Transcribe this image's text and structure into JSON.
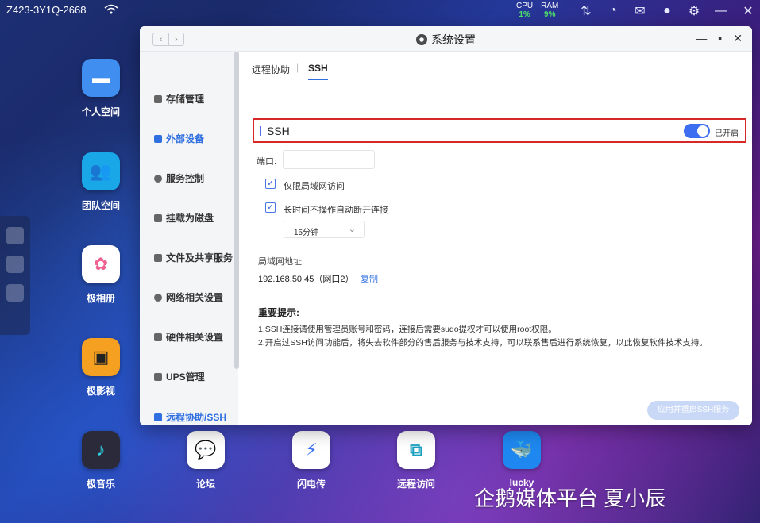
{
  "topbar": {
    "device_name": "Z423-3Y1Q-2668",
    "cpu_label": "CPU",
    "cpu_value": "1%",
    "ram_label": "RAM",
    "ram_value": "9%",
    "icons": [
      "transfer-icon",
      "speed-icon",
      "mail-icon",
      "user-icon",
      "gear-icon",
      "minimize-icon",
      "close-icon"
    ]
  },
  "desktop": {
    "icons": [
      {
        "label": "个人空间",
        "color": "#3f8ef0"
      },
      {
        "label": "团队空间",
        "color": "#1aa7e8"
      },
      {
        "label": "极相册",
        "color": "#ffffff"
      },
      {
        "label": "极影视",
        "color": "#f5a020"
      },
      {
        "label": "极音乐",
        "color": "#2a2a3a"
      },
      {
        "label": "论坛",
        "color": "#ffffff"
      },
      {
        "label": "闪电传",
        "color": "#ffffff"
      },
      {
        "label": "远程访问",
        "color": "#ffffff"
      },
      {
        "label": "lucky",
        "color": "#1e88f0"
      }
    ]
  },
  "window": {
    "title": "系统设置",
    "sidebar": [
      {
        "label": "存储管理"
      },
      {
        "label": "外部设备"
      },
      {
        "label": "服务控制"
      },
      {
        "label": "挂载为磁盘"
      },
      {
        "label": "文件及共享服务"
      },
      {
        "label": "网络相关设置"
      },
      {
        "label": "硬件相关设置"
      },
      {
        "label": "UPS管理"
      },
      {
        "label": "远程协助/SSH"
      }
    ],
    "tabs": {
      "remote": "远程协助",
      "ssh": "SSH"
    },
    "ssh": {
      "label": "SSH",
      "toggle_state": "已开启",
      "enabled": true,
      "port_label": "端口:",
      "port_value": "",
      "lan_only_label": "仅限局域网访问",
      "auto_disconnect_label": "长时间不操作自动断开连接",
      "timeout_value": "15分钟",
      "lan_address_label": "局域网地址:",
      "lan_address_value": "192.168.50.45（网口2）",
      "copy_label": "复制",
      "important_title": "重要提示:",
      "note1": "1.SSH连接请使用管理员账号和密码，连接后需要sudo提权才可以使用root权限。",
      "note2": "2.开启过SSH访问功能后，将失去软件部分的售后服务与技术支持，可以联系售后进行系统恢复，以此恢复软件技术支持。",
      "apply_label": "应用并重启SSH服务"
    }
  },
  "watermark": "企鹅媒体平台 夏小辰"
}
